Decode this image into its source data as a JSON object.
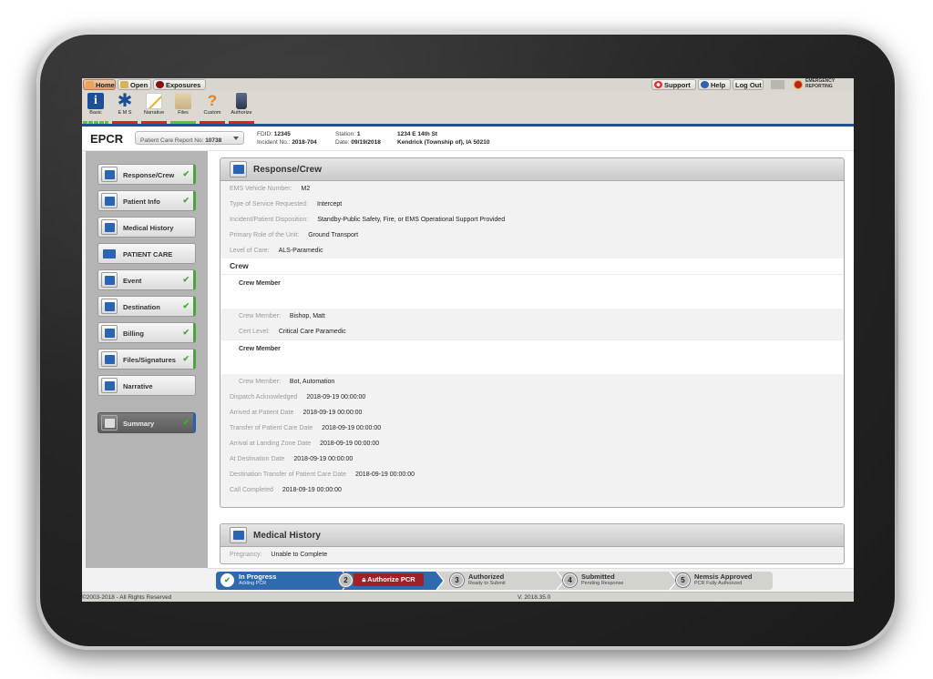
{
  "nav_tabs": [
    {
      "label": "Home",
      "icon": "home-icon",
      "active": true
    },
    {
      "label": "Open",
      "icon": "folder-open-icon",
      "active": false
    },
    {
      "label": "Exposures",
      "icon": "exposures-icon",
      "active": false
    }
  ],
  "right_tabs": [
    {
      "label": "Support",
      "icon": "lifebuoy-icon"
    },
    {
      "label": "Help",
      "icon": "help-icon"
    },
    {
      "label": "Log Out"
    }
  ],
  "brand": {
    "line1": "EMERGENCY",
    "line2": "REPORTING"
  },
  "toolbar": [
    {
      "label": "Basic",
      "icon": "info-icon",
      "status": "complete",
      "status_color": "#5cc23c"
    },
    {
      "label": "E M S",
      "icon": "star-of-life-icon",
      "status": "incomplete",
      "status_color": "#e02020"
    },
    {
      "label": "Narrative",
      "icon": "narrative-icon",
      "status": "incomplete",
      "status_color": "#e02020"
    },
    {
      "label": "Files",
      "icon": "folder-icon",
      "status": "complete",
      "status_color": "#5cc23c"
    },
    {
      "label": "Custom",
      "icon": "custom-form-icon",
      "status": "incomplete",
      "status_color": "#e02020"
    },
    {
      "label": "Authorize",
      "icon": "padlock-icon",
      "status": "incomplete",
      "status_color": "#e02020"
    }
  ],
  "header": {
    "app": "EPCR",
    "pcr_label": "Patient Care Report No:",
    "pcr_number": "10738",
    "fdid_label": "FDID:",
    "fdid": "12345",
    "incident_label": "Incident No.:",
    "incident": "2018-704",
    "station_label": "Station:",
    "station": "1",
    "date_label": "Date:",
    "date": "09/19/2018",
    "address1": "1234 E 14th St",
    "address2": "Kendrick (Township of), IA 50210"
  },
  "sidebar": [
    {
      "label": "Response/Crew",
      "icon": "ambulance-icon",
      "done": true
    },
    {
      "label": "Patient Info",
      "icon": "patient-info-icon",
      "done": true
    },
    {
      "label": "Medical History",
      "icon": "medical-history-icon",
      "done": false
    },
    {
      "label": "PATIENT CARE",
      "icon": "medkit-icon",
      "done": false
    },
    {
      "label": "Event",
      "icon": "event-icon",
      "done": true
    },
    {
      "label": "Destination",
      "icon": "destination-icon",
      "done": true
    },
    {
      "label": "Billing",
      "icon": "billing-icon",
      "done": true
    },
    {
      "label": "Files/Signatures",
      "icon": "signature-icon",
      "done": true
    },
    {
      "label": "Narrative",
      "icon": "pencil-icon",
      "done": false
    },
    {
      "label": "Summary",
      "icon": "unlock-icon",
      "done": true
    }
  ],
  "response": {
    "title": "Response/Crew",
    "fields": [
      {
        "k": "EMS Vehicle Number:",
        "v": "M2"
      },
      {
        "k": "Type of Service Requested:",
        "v": "Intercept"
      },
      {
        "k": "Incident/Patient Disposition:",
        "v": "Standby-Public Safety, Fire, or EMS Operational Support Provided"
      },
      {
        "k": "Primary Role of the Unit:",
        "v": "Ground Transport"
      },
      {
        "k": "Level of Care:",
        "v": "ALS-Paramedic"
      }
    ],
    "crew_title": "Crew",
    "crew_card_title": "Crew Member",
    "crew": [
      {
        "member_k": "Crew Member:",
        "member": "Bishop, Matt",
        "cert_k": "Cert Level:",
        "cert": "Critical Care Paramedic"
      },
      {
        "member_k": "Crew Member:",
        "member": "Bot, Automation"
      }
    ],
    "times": [
      {
        "k": "Dispatch Acknowledged",
        "v": "2018-09-19 00:00:00"
      },
      {
        "k": "Arrived at Patient Date",
        "v": "2018-09-19 00:00:00"
      },
      {
        "k": "Transfer of Patient Care Date",
        "v": "2018-09-19 00:00:00"
      },
      {
        "k": "Arrival at Landing Zone Date",
        "v": "2018-09-19 00:00:00"
      },
      {
        "k": "At Destination Date",
        "v": "2018-09-19 00:00:00"
      },
      {
        "k": "Destination Transfer of Patient Care Date",
        "v": "2018-09-19 00:00:00"
      },
      {
        "k": "Call Completed",
        "v": "2018-09-19 00:00:00"
      }
    ]
  },
  "medical_history": {
    "title": "Medical History",
    "fields": [
      {
        "k": "Pregnancy:",
        "v": "Unable to Complete"
      }
    ]
  },
  "progress": {
    "steps": [
      {
        "num": "1",
        "title": "In Progress",
        "sub": "Adding PCR",
        "state": "current"
      },
      {
        "num": "2",
        "button": "Authorize PCR",
        "state": "action"
      },
      {
        "num": "3",
        "title": "Authorized",
        "sub": "Ready to Submit",
        "state": "pending"
      },
      {
        "num": "4",
        "title": "Submitted",
        "sub": "Pending Response",
        "state": "pending"
      },
      {
        "num": "5",
        "title": "Nemsis Approved",
        "sub": "PCR Fully Authorized",
        "state": "pending"
      }
    ],
    "current_color": "#2f6aae",
    "action_color": "#a11f25"
  },
  "footer": {
    "copyright": "©2003-2018 - All Rights Reserved",
    "version": "V. 2018.35.0"
  }
}
